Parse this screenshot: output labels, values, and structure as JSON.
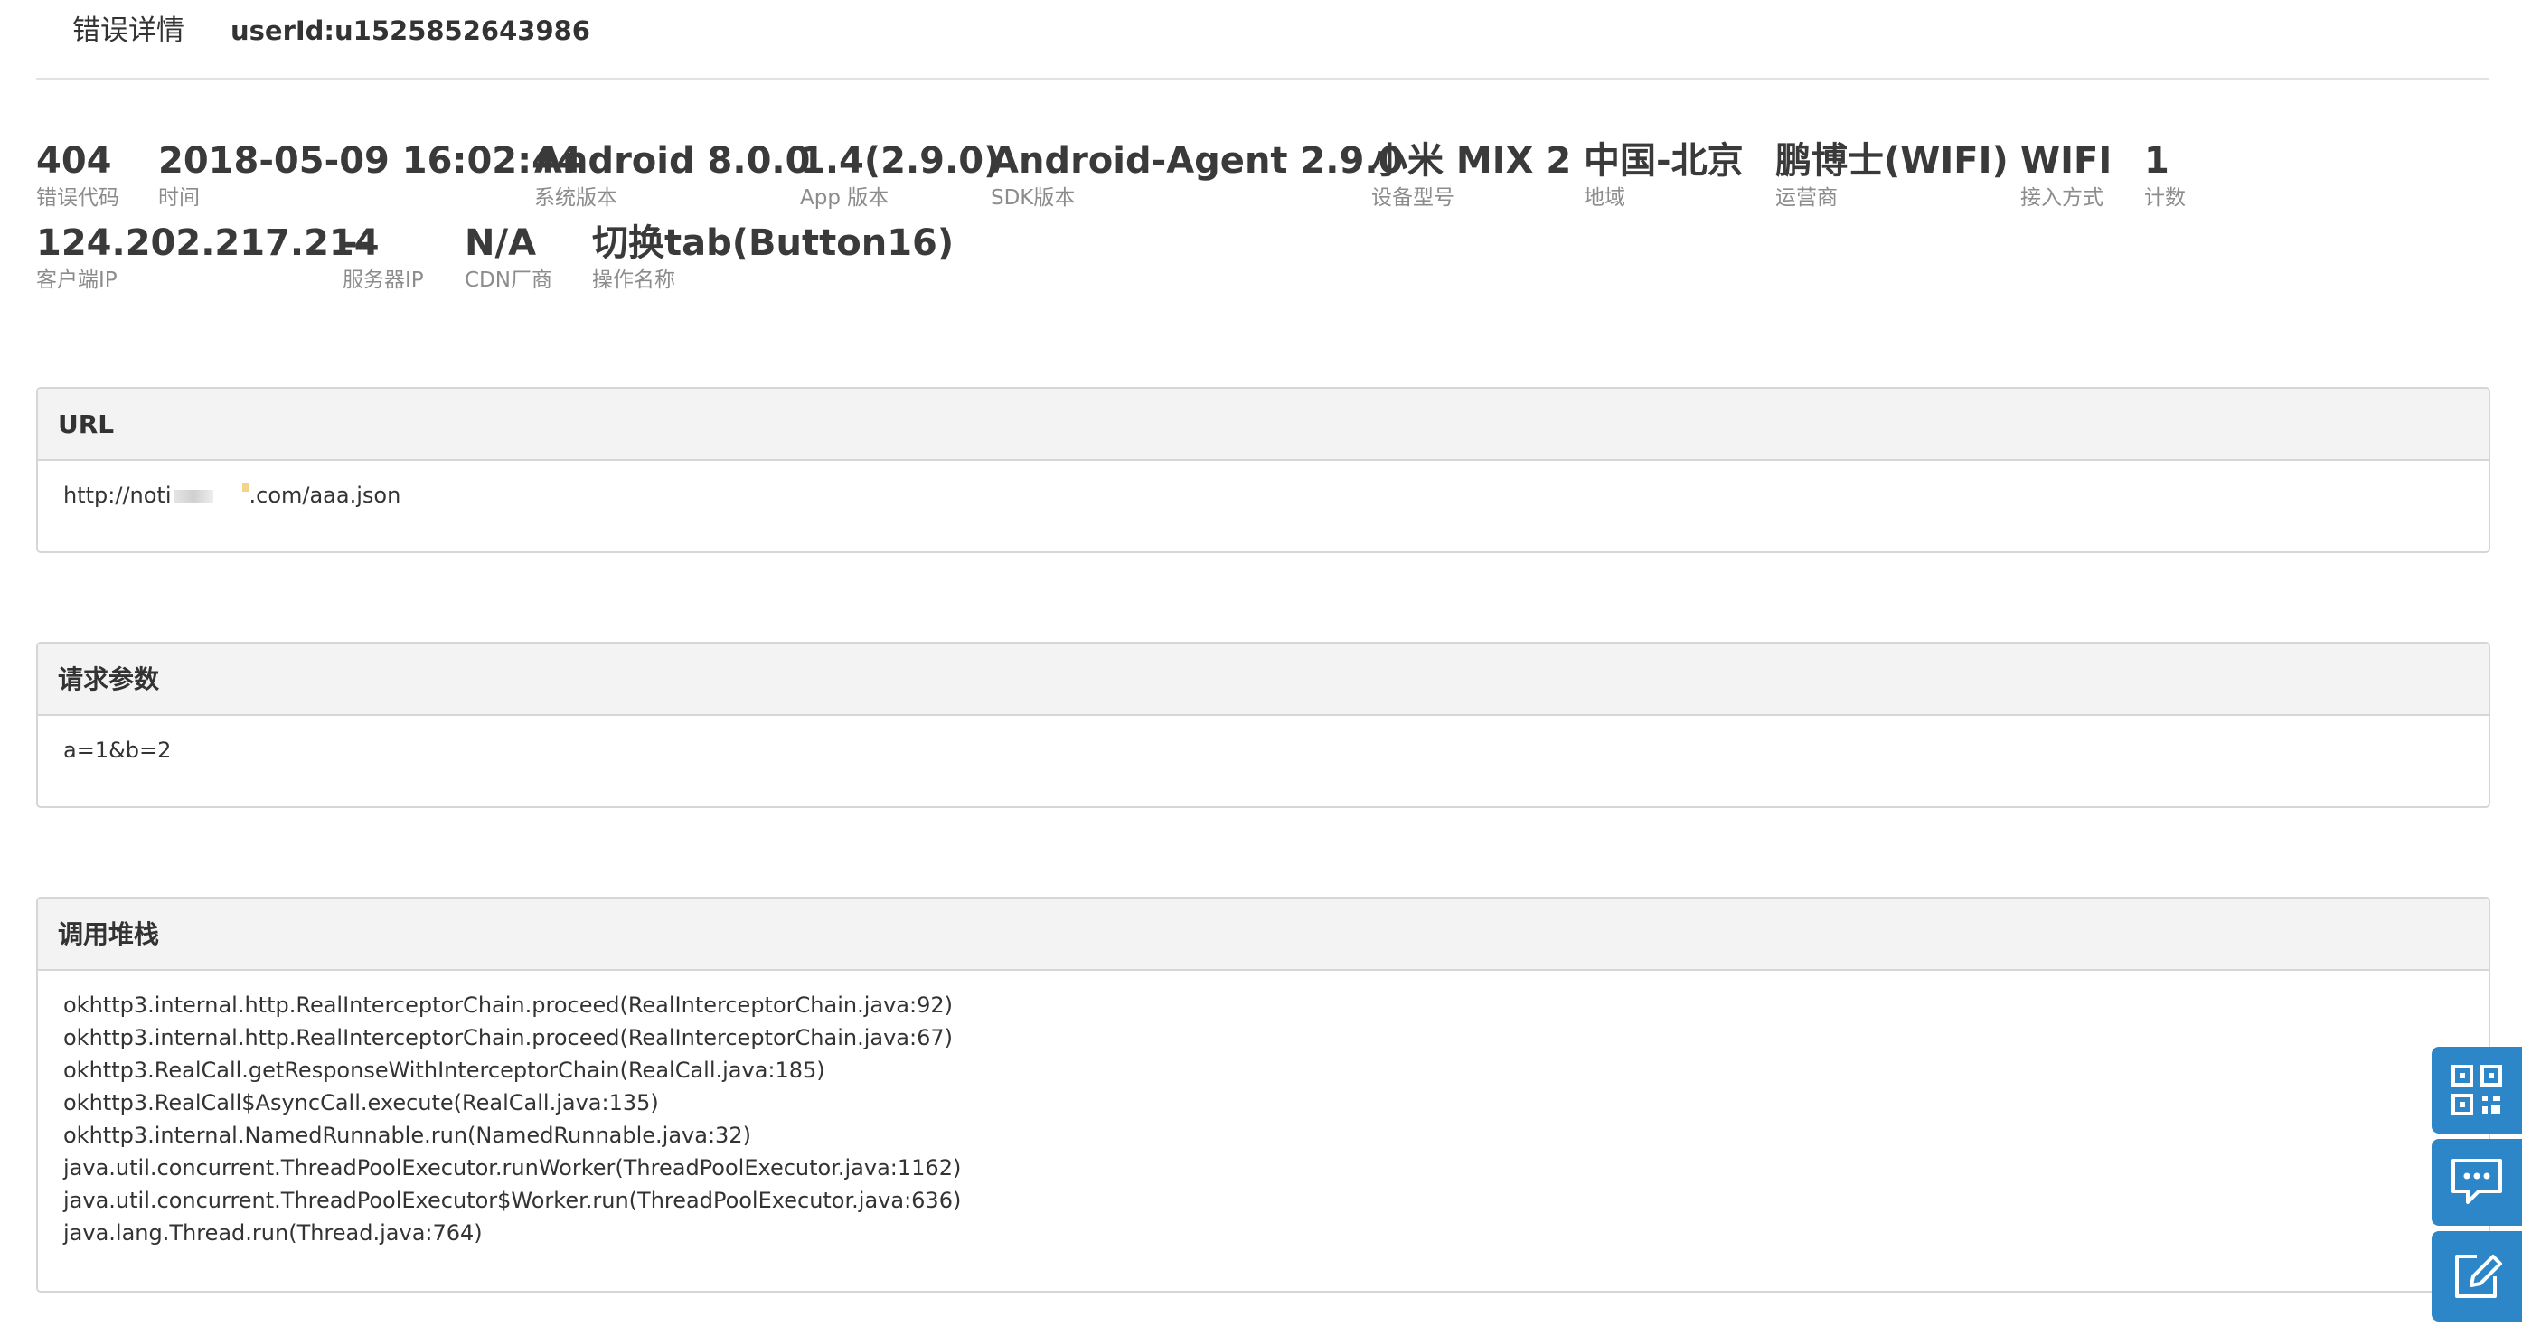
{
  "header": {
    "title": "错误详情",
    "user_id": "userId:u1525852643986"
  },
  "metrics_row1": [
    {
      "value": "404",
      "label": "错误代码"
    },
    {
      "value": "2018-05-09 16:02:44",
      "label": "时间"
    },
    {
      "value": "Android 8.0.0",
      "label": "系统版本"
    },
    {
      "value": "1.4(2.9.0)",
      "label": "App 版本"
    },
    {
      "value": "Android-Agent 2.9.0",
      "label": "SDK版本"
    },
    {
      "value": "小米 MIX 2",
      "label": "设备型号"
    },
    {
      "value": "中国-北京",
      "label": "地域"
    },
    {
      "value": "鹏博士(WIFI)",
      "label": "运营商"
    },
    {
      "value": "WIFI",
      "label": "接入方式"
    },
    {
      "value": "1",
      "label": "计数"
    }
  ],
  "metrics_row2": [
    {
      "value": "124.202.217.214",
      "label": "客户端IP"
    },
    {
      "value": "--",
      "label": "服务器IP"
    },
    {
      "value": "N/A",
      "label": "CDN厂商"
    },
    {
      "value": "切换tab(Button16)",
      "label": "操作名称"
    }
  ],
  "url_panel": {
    "title": "URL",
    "url_prefix": "http://noti",
    "url_suffix": ".com/aaa.json"
  },
  "params_panel": {
    "title": "请求参数",
    "value": "a=1&b=2"
  },
  "stack_panel": {
    "title": "调用堆栈",
    "lines": [
      "okhttp3.internal.http.RealInterceptorChain.proceed(RealInterceptorChain.java:92)",
      "okhttp3.internal.http.RealInterceptorChain.proceed(RealInterceptorChain.java:67)",
      "okhttp3.RealCall.getResponseWithInterceptorChain(RealCall.java:185)",
      "okhttp3.RealCall$AsyncCall.execute(RealCall.java:135)",
      "okhttp3.internal.NamedRunnable.run(NamedRunnable.java:32)",
      "java.util.concurrent.ThreadPoolExecutor.runWorker(ThreadPoolExecutor.java:1162)",
      "java.util.concurrent.ThreadPoolExecutor$Worker.run(ThreadPoolExecutor.java:636)",
      "java.lang.Thread.run(Thread.java:764)"
    ]
  },
  "side_toolbar": {
    "color": "#2d86c8",
    "buttons": [
      "qr-code-icon",
      "chat-icon",
      "edit-icon"
    ]
  }
}
